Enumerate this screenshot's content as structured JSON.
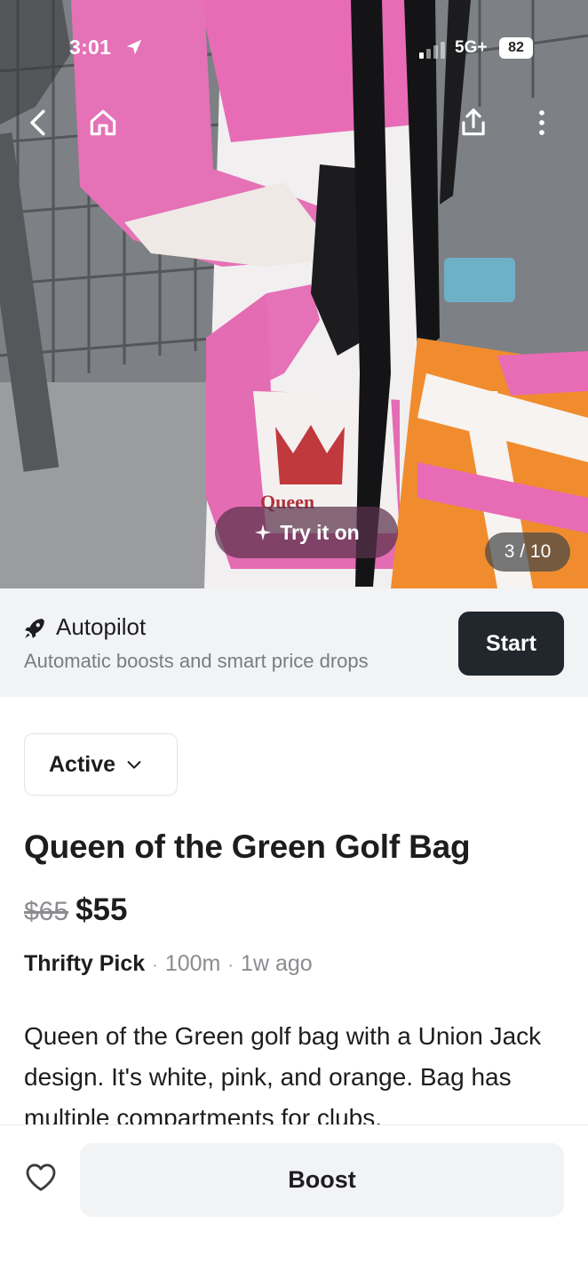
{
  "status_bar": {
    "time": "3:01",
    "network": "5G+",
    "battery": "82"
  },
  "photo": {
    "description_icon": "product-photo",
    "logo_text": "Queen",
    "try_on_label": "Try it on",
    "page_indicator": "3 / 10"
  },
  "autopilot": {
    "title": "Autopilot",
    "subtitle": "Automatic boosts and smart price drops",
    "start_label": "Start"
  },
  "listing": {
    "status": "Active",
    "title": "Queen of the Green Golf Bag",
    "original_price": "$65",
    "price": "$55",
    "seller": "Thrifty Pick",
    "distance": "100m",
    "age": "1w ago",
    "description": "Queen of the Green golf bag with a Union Jack design. It's white, pink, and orange. Bag has multiple compartments for clubs."
  },
  "bottom_bar": {
    "boost_label": "Boost"
  },
  "colors": {
    "accent_dark": "#22272d",
    "banner_bg": "#f2f3f5",
    "muted_text": "#7a7c80"
  }
}
